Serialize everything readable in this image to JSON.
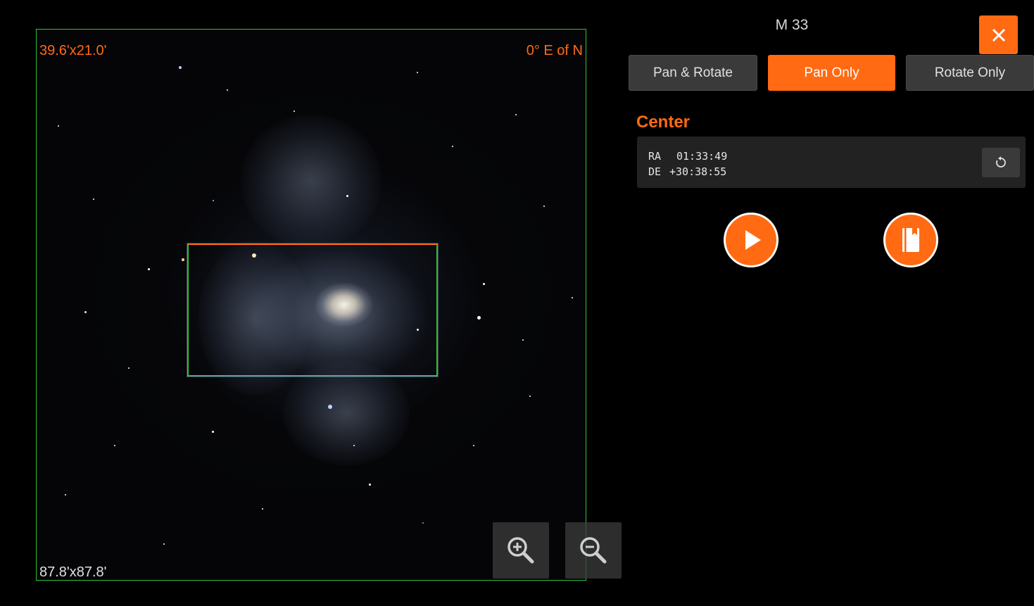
{
  "colors": {
    "accent": "#ff6a13",
    "frame_border": "#2fbf3a",
    "panel_bg": "#222222",
    "button_bg": "#3a3a3a",
    "background": "#000000"
  },
  "viewer": {
    "fov_label": "39.6'x21.0'",
    "rotation_label": "0° E of N",
    "image_size_label": "87.8'x87.8'",
    "zoom_in_icon": "zoom-in-icon",
    "zoom_out_icon": "zoom-out-icon"
  },
  "header": {
    "object_name": "M 33",
    "close_icon": "close-icon"
  },
  "modes": [
    {
      "label": "Pan & Rotate",
      "active": false
    },
    {
      "label": "Pan Only",
      "active": true
    },
    {
      "label": "Rotate Only",
      "active": false
    }
  ],
  "center": {
    "section_label": "Center",
    "ra_label": "RA",
    "ra_value": "01:33:49",
    "de_label": "DE",
    "de_value": "+30:38:55",
    "reset_icon": "refresh-icon"
  },
  "actions": {
    "play_icon": "play-icon",
    "notebook_icon": "notebook-icon"
  }
}
